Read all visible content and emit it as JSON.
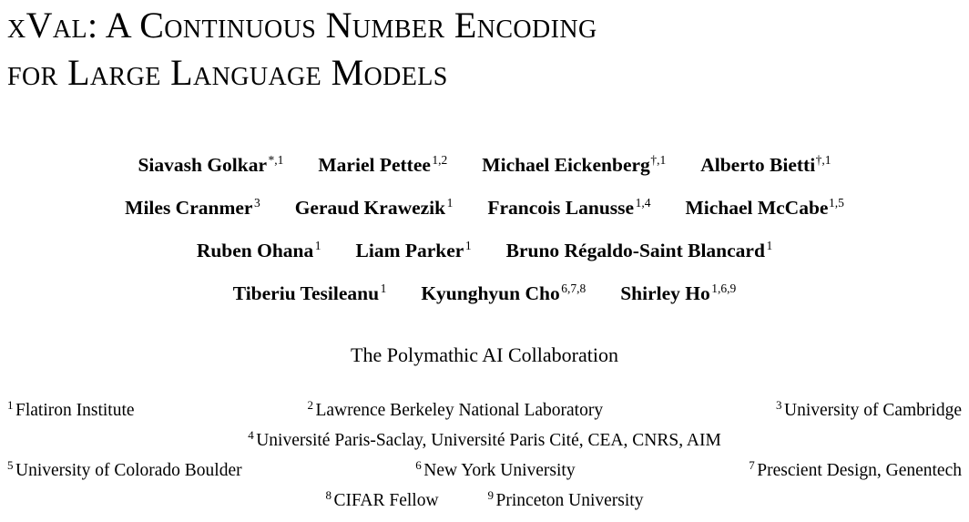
{
  "paper": {
    "title_lines": [
      "xVal: A Continuous Number Encoding",
      "for Large Language Models"
    ],
    "collaboration": "The Polymathic AI Collaboration",
    "author_rows": [
      [
        {
          "name": "Siavash Golkar",
          "marks": "*,1"
        },
        {
          "name": "Mariel Pettee",
          "marks": "1,2"
        },
        {
          "name": "Michael Eickenberg",
          "marks": "†,1"
        },
        {
          "name": "Alberto Bietti",
          "marks": "†,1"
        }
      ],
      [
        {
          "name": "Miles Cranmer",
          "marks": "3"
        },
        {
          "name": "Geraud Krawezik",
          "marks": "1"
        },
        {
          "name": "Francois Lanusse",
          "marks": "1,4"
        },
        {
          "name": "Michael McCabe",
          "marks": "1,5"
        }
      ],
      [
        {
          "name": "Ruben Ohana",
          "marks": "1"
        },
        {
          "name": "Liam Parker",
          "marks": "1"
        },
        {
          "name": "Bruno Régaldo-Saint Blancard",
          "marks": "1"
        }
      ],
      [
        {
          "name": "Tiberiu Tesileanu",
          "marks": "1"
        },
        {
          "name": "Kyunghyun Cho",
          "marks": "6,7,8"
        },
        {
          "name": "Shirley Ho",
          "marks": "1,6,9"
        }
      ]
    ],
    "affiliation_rows": [
      [
        {
          "index": "1",
          "name": "Flatiron Institute"
        },
        {
          "index": "2",
          "name": "Lawrence Berkeley National Laboratory"
        },
        {
          "index": "3",
          "name": "University of Cambridge"
        }
      ],
      [
        {
          "index": "4",
          "name": "Université Paris-Saclay, Université Paris Cité, CEA, CNRS, AIM"
        }
      ],
      [
        {
          "index": "5",
          "name": "University of Colorado Boulder"
        },
        {
          "index": "6",
          "name": "New York University"
        },
        {
          "index": "7",
          "name": "Prescient Design, Genentech"
        }
      ],
      [
        {
          "index": "8",
          "name": "CIFAR Fellow"
        },
        {
          "index": "9",
          "name": "Princeton University"
        }
      ]
    ]
  }
}
